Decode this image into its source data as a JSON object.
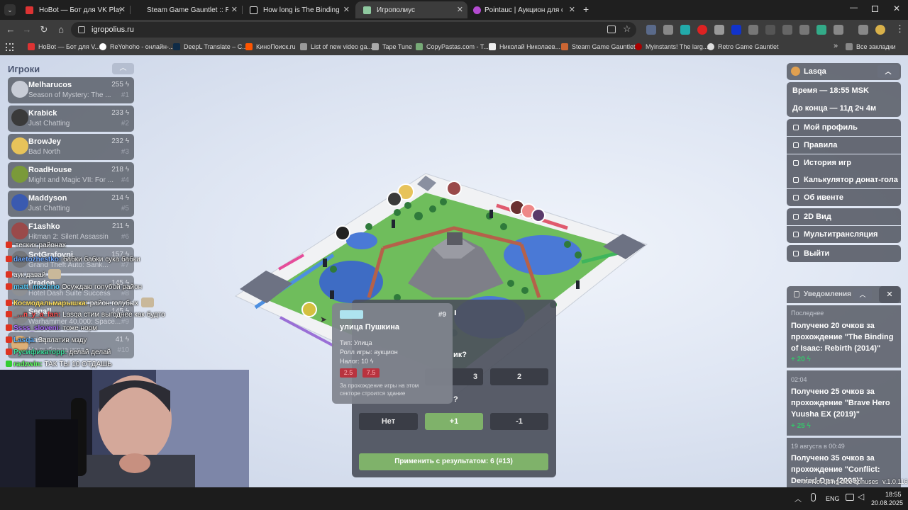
{
  "browser": {
    "tabs": [
      {
        "title": "HoBot — Бот для VK Play Live",
        "color": "#d33"
      },
      {
        "title": "Steam Game Gauntlet :: Random",
        "color": "#1b2838"
      },
      {
        "title": "How long is The Binding of Isaac",
        "color": "#222"
      },
      {
        "title": "Игрополиус",
        "color": "#8fc9a0"
      },
      {
        "title": "Pointauc | Аукцион для стримо",
        "color": "#b44bd1"
      }
    ],
    "url": "igropolius.ru",
    "bookmarks": [
      "HoBot — Бот для V...",
      "ReYohoho - онлайн-...",
      "DeepL Translate – C...",
      "КиноПоиск.ru",
      "List of new video ga...",
      "Tape Tune",
      "CopyPastas.com - T...",
      "Николай Николаев...",
      "Steam Game Gauntlet",
      "Myinstants! The larg...",
      "Retro Game Gauntlet"
    ],
    "all_bookmarks": "Все закладки"
  },
  "players_panel": {
    "title": "Игроки",
    "players": [
      {
        "name": "Melharucos",
        "game": "Season of Mystery: The ...",
        "score": "255",
        "rank": "#1",
        "color": "#c8ccd6"
      },
      {
        "name": "Krabick",
        "game": "Just Chatting",
        "score": "233",
        "rank": "#2",
        "color": "#3a3a3a"
      },
      {
        "name": "BrowJey",
        "game": "Bad North",
        "score": "232",
        "rank": "#3",
        "color": "#e7c35a"
      },
      {
        "name": "RoadHouse",
        "game": "Might and Magic VII: For ...",
        "score": "218",
        "rank": "#4",
        "color": "#7a9a3a"
      },
      {
        "name": "Maddyson",
        "game": "Just Chatting",
        "score": "214",
        "rank": "#5",
        "color": "#3a5ab0"
      },
      {
        "name": "F1ashko",
        "game": "Hitman 2: Silent Assassin",
        "score": "211",
        "rank": "#6",
        "color": "#9a4a4a"
      },
      {
        "name": "SotGrafovni",
        "game": "Grand Theft Auto: Sank...",
        "score": "157",
        "rank": "#7",
        "color": "#555"
      },
      {
        "name": "Praden",
        "game": "Hotel Dash Suite Success",
        "score": "145",
        "rank": "#8",
        "color": "#777"
      },
      {
        "name": "Segall",
        "game": "Warhammer 40,000: Space...",
        "score": "145",
        "rank": "#9",
        "color": "#6a6a6a"
      },
      {
        "name": "Lasqa",
        "game": "Не выбрана игра",
        "score": "41",
        "rank": "#10",
        "color": "#e0a050"
      }
    ]
  },
  "chat": [
    {
      "user": "",
      "text": "теских районах",
      "ucolor": "#fff"
    },
    {
      "user": "daetozhestko:",
      "text": "бабки  бабки  сука  бабки",
      "ucolor": "#6fa8ff"
    },
    {
      "user": "",
      "text": "аук давай",
      "ucolor": "#fff"
    },
    {
      "user": "matt_mozhno",
      "text": "Осуждаю голубой район",
      "ucolor": "#5ad0ff"
    },
    {
      "user": "Космодальмарышка:",
      "text": "район голубых",
      "ucolor": "#ffe060"
    },
    {
      "user": "_...n_y_a_fan:",
      "text": "Lasqa стим выгоднее как будто",
      "ucolor": "#ff5050"
    },
    {
      "user": "Ssss_sloveni:",
      "text": "тоже норм",
      "ucolor": "#b070ff"
    },
    {
      "user": "Lasqa:",
      "text": "Заплатив мзду",
      "ucolor": "#5ab0ff"
    },
    {
      "user": "Русификаторр:",
      "text": "делай делай",
      "ucolor": "#40e0a0"
    },
    {
      "user": "radzwin:",
      "text": "ТАК ТЫ 10 ОТДАШЬ",
      "ucolor": "#60ff60"
    }
  ],
  "tooltip": {
    "rank": "#9",
    "title": "улица Пушкина",
    "type": "Тип: Улица",
    "roll": "Ролл игры: аукцион",
    "tax": "Налог: 10",
    "badges": [
      "2.5",
      "7.5"
    ],
    "note": "За прохождение игры на этом секторе строится здание"
  },
  "dialog": {
    "question_suffix": "ик?",
    "opt_3": "3",
    "opt_2": "2",
    "no_label": "Нет",
    "plus_label": "+1",
    "minus_label": "-1",
    "apply_label": "Применить с результатом: 6 (#13)"
  },
  "right_panel": {
    "user": "Lasqa",
    "time": "Время — 18:55 MSK",
    "until_end": "До конца — 11д 2ч 4м",
    "menu": [
      "Мой профиль",
      "Правила",
      "История игр",
      "Калькулятор донат-гола",
      "Об ивенте"
    ],
    "view_2d": "2D Вид",
    "multistream": "Мультитрансляция",
    "logout": "Выйти",
    "notifications_title": "Уведомления",
    "notifications": [
      {
        "time": "Последнее",
        "text": "Получено 20 очков за прохождение \"The Binding of Isaac: Rebirth (2014)\"",
        "points": "+ 20"
      },
      {
        "time": "02:04",
        "text": "Получено 25 очков за прохождение \"Brave Hero Yuusha EX (2019)\"",
        "points": "+ 25"
      },
      {
        "time": "19 августа в 00:49",
        "text": "Получено 35 очков за прохождение \"Conflict: Denied Ops (2008)\"",
        "points": ""
      }
    ]
  },
  "footer_overlay": {
    "left": "#7 Not using dice bonuses",
    "version": "v.1.0.116"
  },
  "taskbar": {
    "lang": "ENG",
    "time": "18:55",
    "date": "20.08.2025"
  }
}
